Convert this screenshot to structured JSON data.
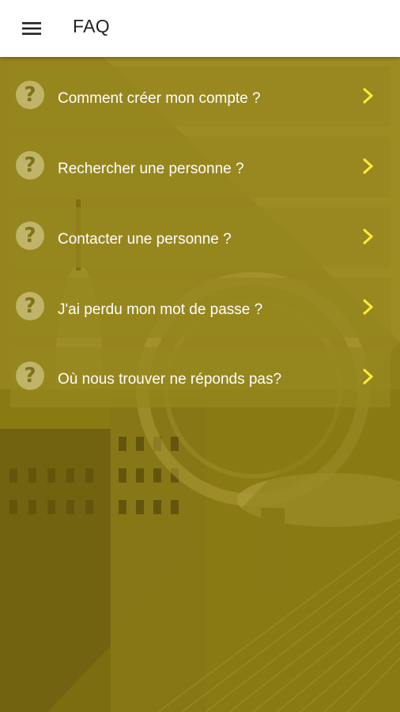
{
  "header": {
    "title": "FAQ",
    "menu_icon": "hamburger-menu-icon"
  },
  "faq": {
    "items": [
      {
        "label": "Comment créer mon compte ?",
        "icon": "question-circle-icon",
        "chevron": "chevron-right-icon"
      },
      {
        "label": "Rechercher une personne ?",
        "icon": "question-circle-icon",
        "chevron": "chevron-right-icon"
      },
      {
        "label": "Contacter une personne ?",
        "icon": "question-circle-icon",
        "chevron": "chevron-right-icon"
      },
      {
        "label": "J'ai perdu mon mot de passe ?",
        "icon": "question-circle-icon",
        "chevron": "chevron-right-icon"
      },
      {
        "label": "Où nous trouver ne réponds pas?",
        "icon": "question-circle-icon",
        "chevron": "chevron-right-icon"
      }
    ]
  },
  "colors": {
    "accent": "#FFEB3B",
    "overlay": "#8C7C12",
    "appbar": "#FFFFFF"
  }
}
